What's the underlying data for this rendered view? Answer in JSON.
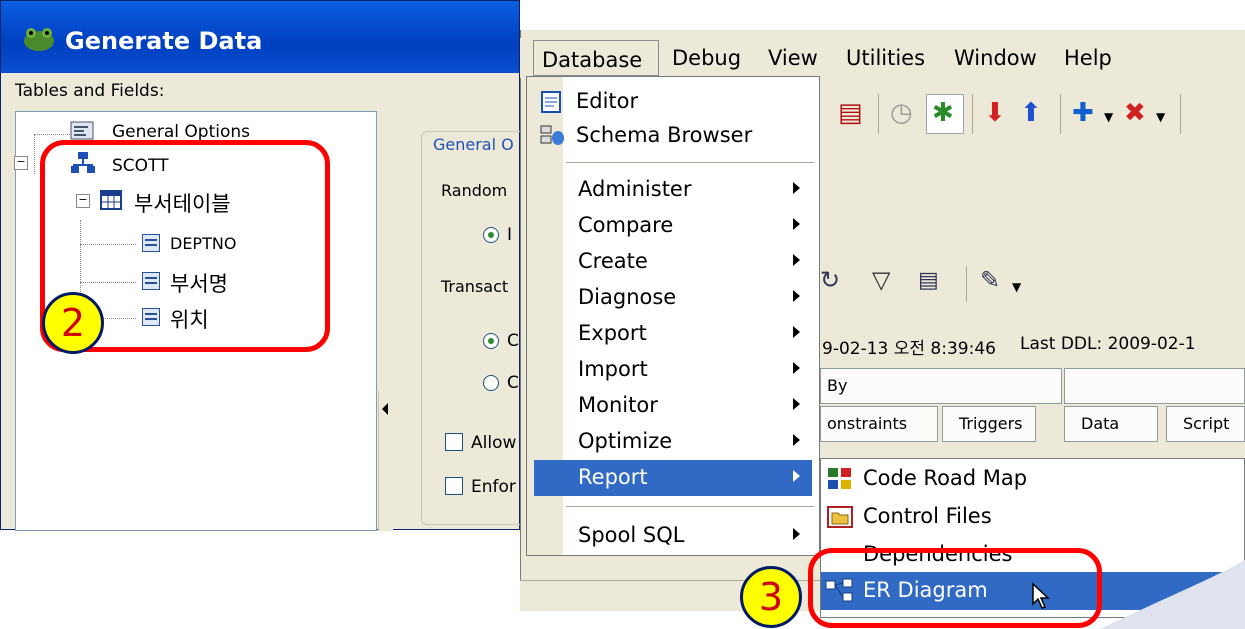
{
  "generate_data": {
    "title": "Generate Data",
    "tables_label": "Tables and Fields:",
    "tree": {
      "general_options": "General Options",
      "schema": "SCOTT",
      "table": "부서테이블",
      "fields": [
        "DEPTNO",
        "부서명",
        "위치"
      ]
    },
    "group_title": "General O",
    "random_label": "Random",
    "radio1": "I",
    "transaction_label": "Transact",
    "radio2": "C",
    "radio3": "C",
    "check1": "Allow",
    "check2": "Enfor"
  },
  "menubar": {
    "items": [
      "Database",
      "Debug",
      "View",
      "Utilities",
      "Window",
      "Help"
    ]
  },
  "database_menu": {
    "items": [
      {
        "label": "Editor",
        "icon": "editor-icon",
        "submenu": false
      },
      {
        "label": "Schema Browser",
        "icon": "schema-browser-icon",
        "submenu": false
      },
      {
        "label": "Administer",
        "submenu": true
      },
      {
        "label": "Compare",
        "submenu": true
      },
      {
        "label": "Create",
        "submenu": true
      },
      {
        "label": "Diagnose",
        "submenu": true
      },
      {
        "label": "Export",
        "submenu": true
      },
      {
        "label": "Import",
        "submenu": true
      },
      {
        "label": "Monitor",
        "submenu": true
      },
      {
        "label": "Optimize",
        "submenu": true
      },
      {
        "label": "Report",
        "submenu": true,
        "highlighted": true
      },
      {
        "label": "Spool SQL",
        "submenu": true
      }
    ]
  },
  "report_submenu": {
    "items": [
      {
        "label": "Code Road Map",
        "icon": "code-road-map-icon"
      },
      {
        "label": "Control Files",
        "icon": "control-files-icon"
      },
      {
        "label": "Dependencies",
        "icon": ""
      },
      {
        "label": "ER Diagram",
        "icon": "er-diagram-icon",
        "highlighted": true
      }
    ]
  },
  "background_window": {
    "created_text": "9-02-13 오전 8:39:46",
    "ddl_text": "Last DDL: 2009-02-1",
    "tab_row1": [
      "By",
      ""
    ],
    "tab_row2": [
      "onstraints",
      "Triggers",
      "Data",
      "Script"
    ]
  },
  "annotations": {
    "badge_tree": "2",
    "badge_er": "3",
    "color": "#ff0000",
    "badge_fill": "#ffff00"
  }
}
